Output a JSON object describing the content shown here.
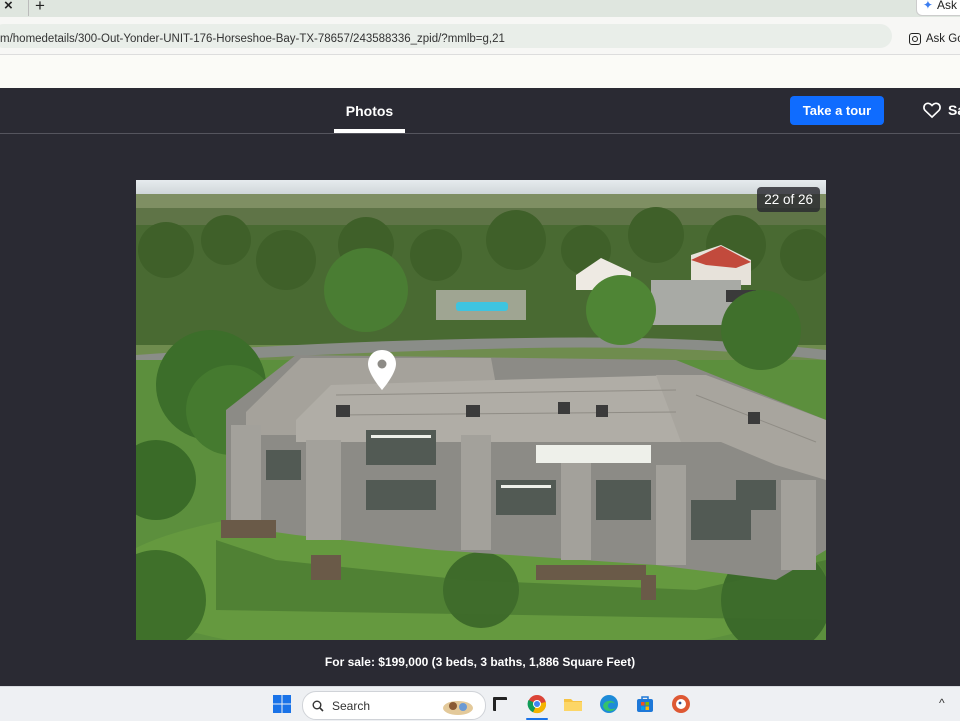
{
  "browser": {
    "tab_close_glyph": "×",
    "new_tab_glyph": "+",
    "ask_pill_label": "Ask",
    "url": "m/homedetails/300-Out-Yonder-UNIT-176-Horseshoe-Bay-TX-78657/243588336_zpid/?mmlb=g,21",
    "ask_google_label": "Ask Goo"
  },
  "modal": {
    "tabs": [
      {
        "label": "Photos",
        "active": true
      }
    ],
    "take_tour_label": "Take a tour",
    "save_label": "Sa",
    "accent_color": "#0f6cff"
  },
  "photo": {
    "counter": "22 of 26",
    "caption": "For sale: $199,000 (3 beds, 3 baths, 1,886 Square Feet)"
  },
  "taskbar": {
    "search_placeholder": "Search",
    "icons": [
      "windows-start-icon",
      "search-icon",
      "task-view-icon",
      "chrome-icon",
      "file-explorer-icon",
      "edge-icon",
      "microsoft-store-icon",
      "duckduckgo-icon",
      "tray-chevron-icon"
    ],
    "tray_chevron_glyph": "^"
  }
}
